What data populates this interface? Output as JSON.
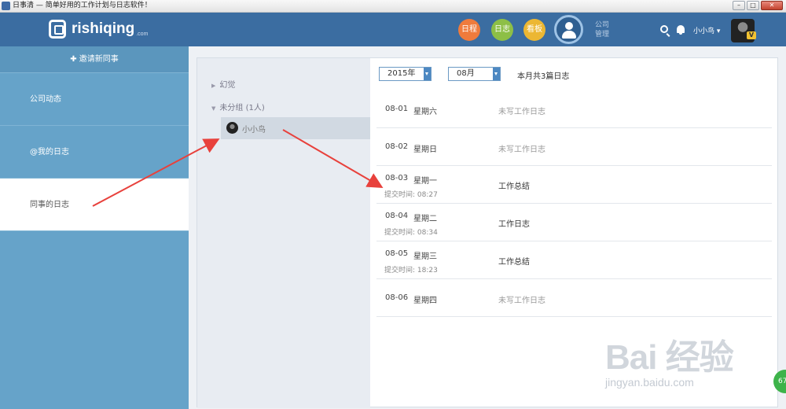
{
  "window": {
    "title": "日事清 — 简单好用的工作计划与日志软件！",
    "buttons": [
      "–",
      "□",
      "✕"
    ]
  },
  "header": {
    "logo_text": "rishiqing",
    "logo_suffix": ".com",
    "nav": [
      {
        "label": "日程",
        "color": "#ef7b3c"
      },
      {
        "label": "日志",
        "color": "#8dbf46"
      },
      {
        "label": "看板",
        "color": "#ecb733"
      }
    ],
    "company_label": "公司管理",
    "user_name": "小小鸟 ▾",
    "badge": "V"
  },
  "sidebar": {
    "invite_label": "邀请新同事",
    "items": [
      {
        "label": "公司动态",
        "active": false
      },
      {
        "label": "@我的日志",
        "active": false
      },
      {
        "label": "同事的日志",
        "active": true
      }
    ]
  },
  "groups": {
    "items": [
      {
        "label": "幻觉",
        "expanded": false
      },
      {
        "label": "未分组 (1人)",
        "expanded": true
      }
    ],
    "member": "小小鸟"
  },
  "filters": {
    "year": "2015年",
    "month": "08月",
    "summary": "本月共3篇日志"
  },
  "journal": [
    {
      "date": "08-01",
      "weekday": "星期六",
      "submit_time": "",
      "status": "未写工作日志",
      "written": false
    },
    {
      "date": "08-02",
      "weekday": "星期日",
      "submit_time": "",
      "status": "未写工作日志",
      "written": false
    },
    {
      "date": "08-03",
      "weekday": "星期一",
      "submit_time": "提交时间: 08:27",
      "status": "工作总结",
      "written": true
    },
    {
      "date": "08-04",
      "weekday": "星期二",
      "submit_time": "提交时间: 08:34",
      "status": "工作日志",
      "written": true
    },
    {
      "date": "08-05",
      "weekday": "星期三",
      "submit_time": "提交时间: 18:23",
      "status": "工作总结",
      "written": true
    },
    {
      "date": "08-06",
      "weekday": "星期四",
      "submit_time": "",
      "status": "未写工作日志",
      "written": false
    }
  ],
  "watermark": {
    "big": "Bai 经验",
    "small": "jingyan.baidu.com"
  },
  "float_badge": "67",
  "colors": {
    "topbar": "#3b6da1",
    "sidebar": "#66a3c9",
    "annotation_arrow": "#e8413c"
  }
}
